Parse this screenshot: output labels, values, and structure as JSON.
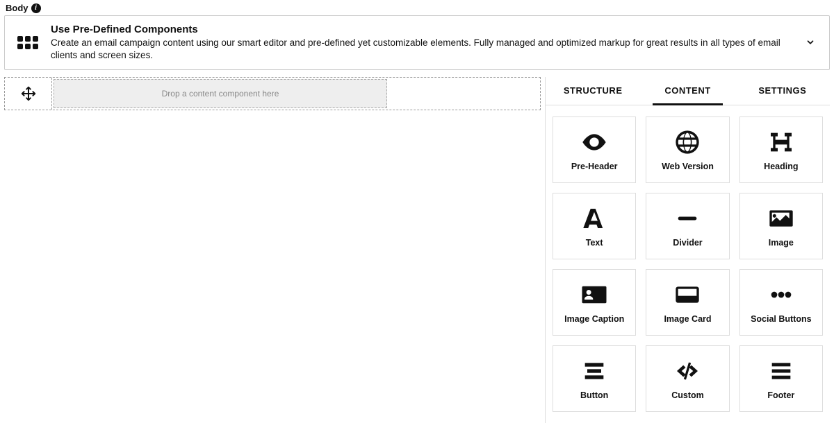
{
  "section_label": "Body",
  "banner": {
    "title": "Use Pre-Defined Components",
    "desc": "Create an email campaign content using our smart editor and pre-defined yet customizable elements. Fully managed and optimized markup for great results in all types of email clients and screen sizes."
  },
  "canvas": {
    "dropzone_text": "Drop a content component here"
  },
  "tabs": {
    "structure": "STRUCTURE",
    "content": "CONTENT",
    "settings": "SETTINGS",
    "active": "content"
  },
  "components": {
    "preheader": "Pre-Header",
    "webversion": "Web Version",
    "heading": "Heading",
    "text": "Text",
    "divider": "Divider",
    "image": "Image",
    "imagecaption": "Image Caption",
    "imagecard": "Image Card",
    "socialbuttons": "Social Buttons",
    "button": "Button",
    "custom": "Custom",
    "footer": "Footer"
  }
}
